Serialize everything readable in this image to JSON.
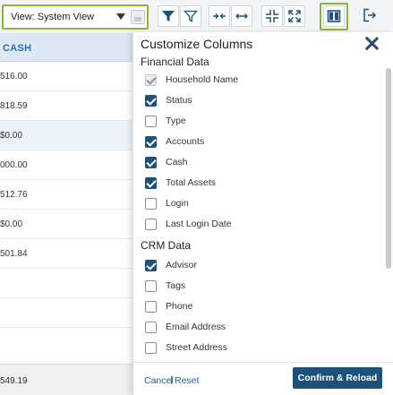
{
  "toolbar": {
    "view_select_value": "View: System View",
    "icons": [
      "chevron-down-icon",
      "save-icon",
      "filter-filled-icon",
      "filter-outline-icon",
      "collapse-horizontal-icon",
      "expand-horizontal-icon",
      "compress-icon",
      "expand-icon",
      "columns-icon",
      "export-icon"
    ],
    "accent_color": "#8ab43c"
  },
  "table": {
    "column_header": "CASH",
    "rows": [
      {
        "value": "516.00"
      },
      {
        "value": "818.59"
      },
      {
        "value": "$0.00"
      },
      {
        "value": "000.00"
      },
      {
        "value": "512.76"
      },
      {
        "value": "$0.00"
      },
      {
        "value": "501.84"
      },
      {
        "value": ""
      },
      {
        "value": ""
      }
    ],
    "footer_total": "549.19"
  },
  "panel": {
    "title": "Customize Columns",
    "sections": [
      {
        "title": "Financial Data",
        "options": [
          {
            "label": "Household Name",
            "state": "disabled-checked"
          },
          {
            "label": "Status",
            "state": "checked"
          },
          {
            "label": "Type",
            "state": "unchecked"
          },
          {
            "label": "Accounts",
            "state": "checked"
          },
          {
            "label": "Cash",
            "state": "checked"
          },
          {
            "label": "Total Assets",
            "state": "checked"
          },
          {
            "label": "Login",
            "state": "unchecked"
          },
          {
            "label": "Last Login Date",
            "state": "unchecked"
          }
        ]
      },
      {
        "title": "CRM Data",
        "options": [
          {
            "label": "Advisor",
            "state": "checked"
          },
          {
            "label": "Tags",
            "state": "unchecked"
          },
          {
            "label": "Phone",
            "state": "unchecked"
          },
          {
            "label": "Email Address",
            "state": "unchecked"
          },
          {
            "label": "Street Address",
            "state": "unchecked"
          }
        ]
      }
    ],
    "cancel_label": "Cancel",
    "separator": "|",
    "reset_label": "Reset",
    "confirm_label": "Confirm & Reload",
    "primary_color": "#1e5179"
  }
}
